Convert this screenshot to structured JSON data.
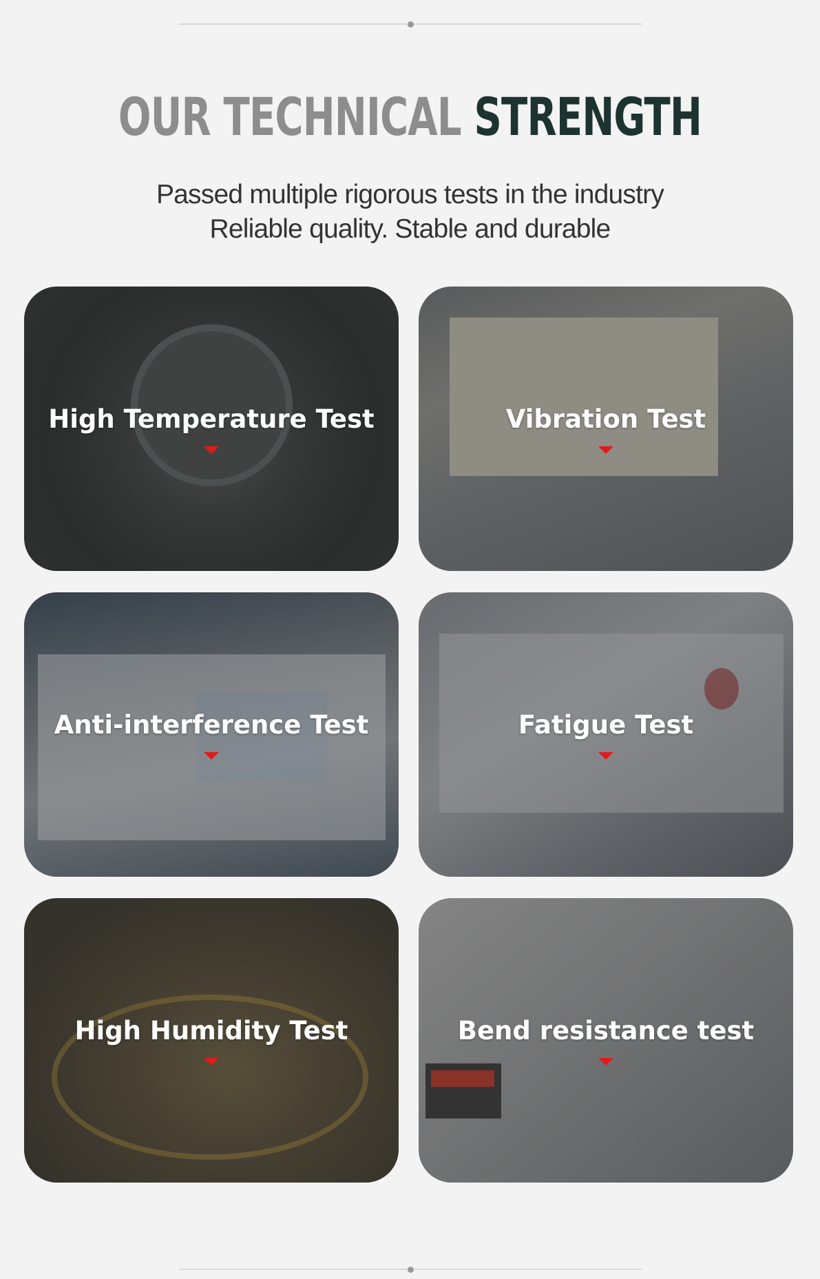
{
  "header": {
    "title_part1": "OUR TECHNICAL",
    "title_part2": "STRENGTH",
    "subtitle_line1": "Passed multiple rigorous tests in the industry",
    "subtitle_line2": "Reliable quality. Stable and durable"
  },
  "cards": [
    {
      "label": "High Temperature Test"
    },
    {
      "label": "Vibration Test"
    },
    {
      "label": "Anti-interference Test"
    },
    {
      "label": "Fatigue Test"
    },
    {
      "label": "High Humidity Test"
    },
    {
      "label": "Bend resistance test"
    }
  ],
  "colors": {
    "title_gray": "#8d8d8d",
    "title_dark": "#1d3330",
    "arrow_red": "#e01b1b",
    "background": "#f3f3f3"
  }
}
